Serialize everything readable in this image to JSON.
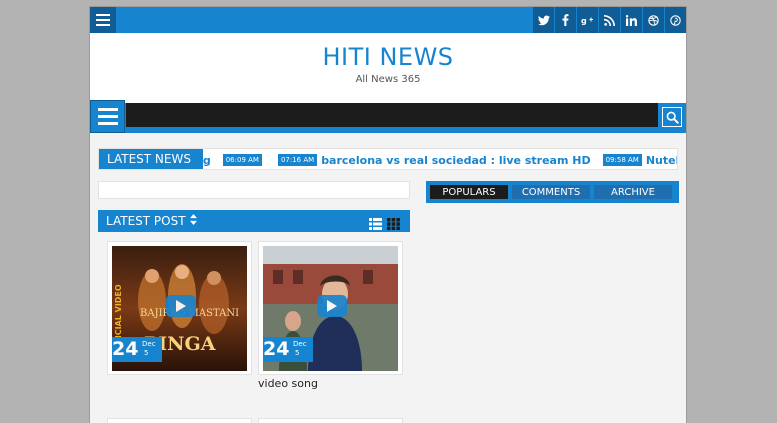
{
  "site": {
    "title": "HITI NEWS",
    "tagline": "All News 365"
  },
  "social_icons": [
    "twitter-icon",
    "facebook-icon",
    "google-plus-icon",
    "rss-icon",
    "linkedin-icon",
    "dribbble-icon",
    "pinterest-icon"
  ],
  "social_glyphs": [
    "t",
    "f",
    "g+",
    "rss",
    "in",
    "db",
    "p"
  ],
  "ticker": {
    "label": "LATEST NEWS",
    "items": [
      {
        "time": "",
        "text": "ng"
      },
      {
        "time": "06:09 AM",
        "text": ""
      },
      {
        "time": "07:16 AM",
        "text": "barcelona vs real sociedad : live stream HD"
      },
      {
        "time": "09:58 AM",
        "text": "Nutella refus"
      }
    ]
  },
  "latest_post": {
    "title": "LATEST POST",
    "sort_icon": "sort-icon",
    "cards": [
      {
        "day": "24",
        "month": "Dec",
        "year": "5",
        "image_text_top": "BAJIRAO MASTANI",
        "image_text_main": "PINGA",
        "image_text_side": "OFFICIAL VIDEO",
        "title": ""
      },
      {
        "day": "24",
        "month": "Dec",
        "year": "5",
        "title": "video song"
      }
    ]
  },
  "widget_tabs": [
    "POPULARS",
    "COMMENTS",
    "ARCHIVE"
  ],
  "colors": {
    "accent": "#1784cf",
    "dark": "#1c1c1c",
    "background": "#b3b3b3"
  }
}
